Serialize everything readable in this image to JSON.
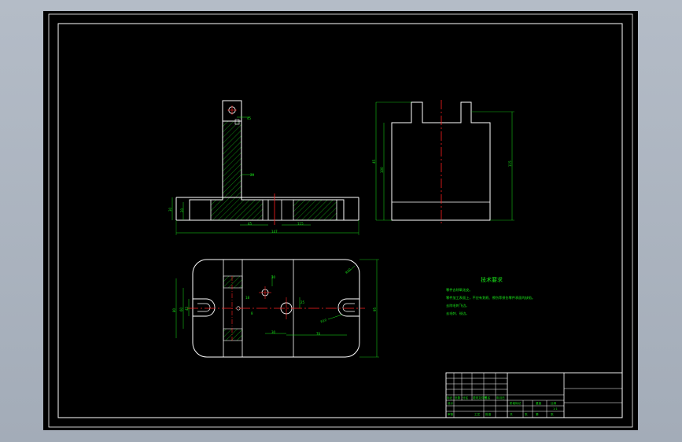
{
  "colors": {
    "background": "#000000",
    "geometry": "#ffffff",
    "dimension": "#19e619",
    "centerline": "#ff2020",
    "hatch": "#19e619",
    "window": "#a5aeba"
  },
  "front_view": {
    "dims": {
      "dim_top_r": "45",
      "dim_web": "20",
      "dim_left_a": "30",
      "dim_left_b": "20",
      "dim_bottom_a": "45",
      "dim_bottom_b": "115",
      "dim_overall": "147"
    }
  },
  "side_view": {
    "dims": {
      "dim_left_outer": "45",
      "dim_left_inner": "100",
      "dim_right": "115"
    }
  },
  "top_view": {
    "dims": {
      "dim_corner_r": "R20",
      "dim_left_1": "80",
      "dim_left_2": "60",
      "dim_left_3": "45",
      "dim_hole_a": "30",
      "dim_hole_b": "25",
      "dim_small_a": "18",
      "dim_small_b": "8",
      "dim_right_slot": "R10",
      "dim_bottom_a": "30",
      "dim_bottom_b": "70",
      "dim_right_h": "95"
    }
  },
  "tech_requirements": {
    "title": "技术要求",
    "lines": [
      "零件去除氧化皮。",
      "零件加工表面上，不应有划痕、擦伤等损伤零件表面的缺陷。",
      "去除毛刺飞边。",
      "去毛刺、锐边。"
    ]
  },
  "title_block": {
    "row_labels": [
      "标记",
      "处数",
      "分区",
      "更改文件号",
      "签名",
      "年月日"
    ],
    "role_labels": [
      "设计",
      "审核",
      "工艺",
      "批准"
    ],
    "field_labels": [
      "阶段标记",
      "重量",
      "比例"
    ],
    "sheet_labels": [
      "共",
      "张",
      "第",
      "张"
    ],
    "scale_value": "1:1"
  }
}
